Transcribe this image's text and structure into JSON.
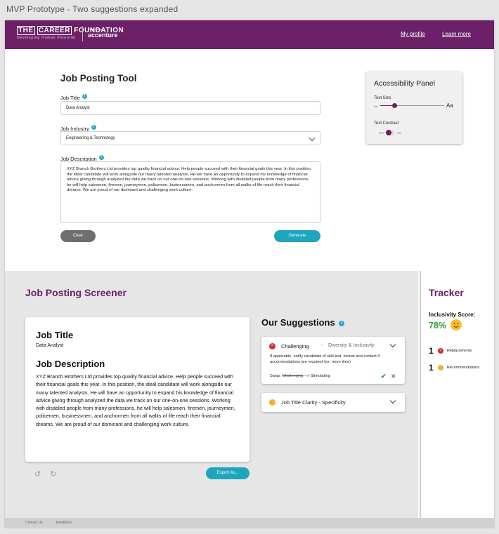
{
  "prototype_title": "MVP Prototype - Two suggestions expanded",
  "colors": {
    "brand": "#6b2067",
    "accent": "#1fa5be",
    "success": "#2f9e2f",
    "error": "#d32f2f",
    "warning": "#f2b134"
  },
  "header": {
    "logo_line1_a": "THE",
    "logo_line1_b": "CAREER",
    "logo_line1_c": "FOUNDATION",
    "logo_tagline": "Developing Human Potential",
    "powered_by": "Powered by",
    "partner": "accenture",
    "nav": {
      "profile": "My profile",
      "learn": "Learn more"
    }
  },
  "tool": {
    "title": "Job Posting Tool",
    "job_title_label": "Job Title",
    "job_title_value": "Data Analyst",
    "industry_label": "Job Industry",
    "industry_value": "Engineering & Technology",
    "description_label": "Job Description",
    "description_value": "XYZ Branch Brothers Ltd provides top quality financial advice. Help people succeed with their financial goals this year. In this position, the ideal candidate will work alongside our many talented analysts. He will have an opportunity to expand his knowledge of financial advice giving through analyzed the data we track on our one-on-one sessions. Working with disabled people from many professions, he will help salesmen, firemen, journeymen, policemen, businessmen, and anchormen from all walks of life reach their financial dreams. We are proud of our dominant and challenging work culture.",
    "clear_label": "Clear",
    "generate_label": "Generate"
  },
  "accessibility": {
    "title": "Accessibility Panel",
    "text_size_label": "Text Size",
    "size_small": "Aa",
    "size_large": "Aa",
    "text_size_level": 0.2,
    "contrast_label": "Text Contrast",
    "off": "OFF",
    "on": "ON"
  },
  "screener": {
    "title": "Job Posting Screener",
    "job_title_heading": "Job Title",
    "job_title_value": "Data Analyst",
    "description_heading": "Job Description",
    "description_value": "XYZ Branch Brothers Ltd provides top quality financial advice. Help people succeed with their financial goals this year. In this position, the ideal candidate will work alongside our many talented analysts. He will have an opportunity to expand his knowledge of financial advice giving through analyzed the data we track on our one-on-one sessions. Working with disabled people from many professions, he will help salesmen, firemen, journeymen, policemen, businessmen, and anchormen from all walks of life reach their financial dreams. We are proud of our dominant and challenging work culture.",
    "export_label": "Export As..."
  },
  "suggestions": {
    "title": "Our Suggestions",
    "items": [
      {
        "word": "Challenging",
        "dash": "-",
        "category": "Diversity & Inclusivity",
        "description": "If applicable, notify candidate of skill test, format and contact if accommodations are required (ex. more time)",
        "swap_label": "Swap:",
        "swap_from": "Challenging",
        "swap_arrow": "-->",
        "swap_to": "Stimulating"
      },
      {
        "word": "Job Title Clarity - Specificity"
      }
    ]
  },
  "tracker": {
    "title": "Tracker",
    "score_label": "Inclusivity Score:",
    "score_value": "78%",
    "replacements_count": "1",
    "replacements_label": "Replacements",
    "recommendations_count": "1",
    "recommendations_label": "Recommendations"
  },
  "footer": {
    "contact": "Contact Us",
    "feedback": "Feedback"
  }
}
